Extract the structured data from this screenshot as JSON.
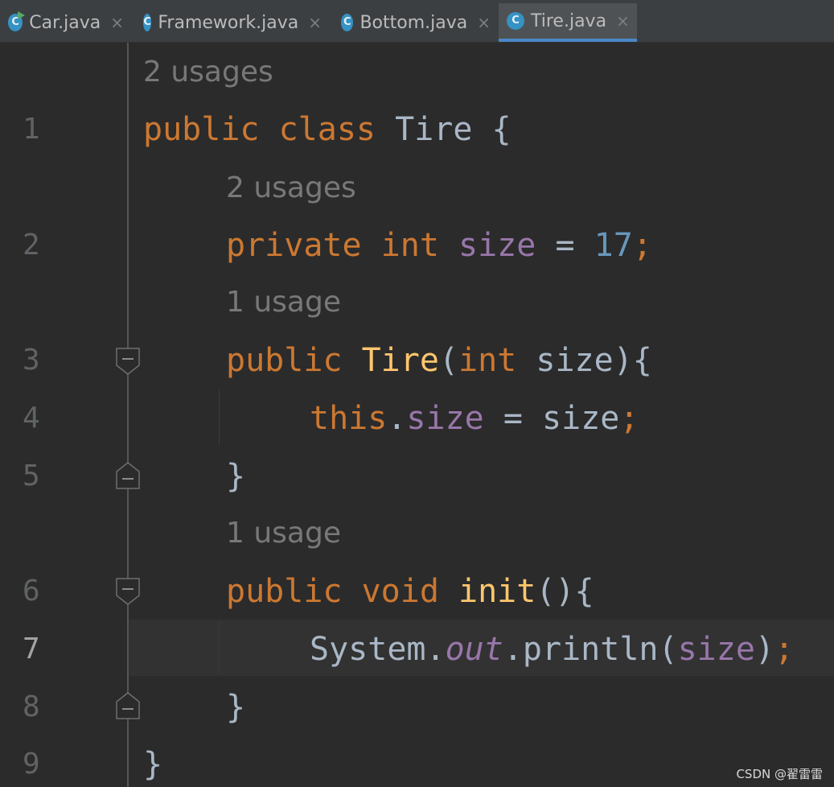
{
  "tabs": [
    {
      "label": "Car.java",
      "icon": "java-class-icon",
      "close": "×",
      "active": false,
      "runnable": true
    },
    {
      "label": "Framework.java",
      "icon": "java-class-icon",
      "close": "×",
      "active": false
    },
    {
      "label": "Bottom.java",
      "icon": "java-class-icon",
      "close": "×",
      "active": false
    },
    {
      "label": "Tire.java",
      "icon": "java-class-icon",
      "close": "×",
      "active": true
    }
  ],
  "file_icon_letter": "C",
  "line_numbers": [
    "1",
    "2",
    "3",
    "4",
    "5",
    "6",
    "7",
    "8",
    "9"
  ],
  "current_line": "7",
  "usage_hints": [
    "2 usages",
    "2 usages",
    "1 usage",
    "1 usage"
  ],
  "code": {
    "l1": {
      "a": "public",
      "b": "class",
      "c": "Tire",
      "d": "{"
    },
    "l2": {
      "a": "private",
      "b": "int",
      "c": "size",
      "d": "=",
      "e": "17",
      "f": ";"
    },
    "l3": {
      "a": "public",
      "b": "Tire",
      "c": "(",
      "d": "int",
      "e": "size",
      "f": "){"
    },
    "l4": {
      "a": "this",
      "b": ".",
      "c": "size",
      "d": "=",
      "e": "size",
      "f": ";"
    },
    "l5": {
      "a": "}"
    },
    "l6": {
      "a": "public",
      "b": "void",
      "c": "init",
      "d": "(){"
    },
    "l7": {
      "a": "System",
      "b": ".",
      "c": "out",
      "d": ".println(",
      "e": "size",
      "f": ")",
      "g": ";"
    },
    "l8": {
      "a": "}"
    },
    "l9": {
      "a": "}"
    }
  },
  "colors": {
    "background": "#2b2b2b",
    "keyword": "#cc7832",
    "field": "#9876aa",
    "method": "#ffc66d",
    "text": "#a9b7c6",
    "hint": "#787878",
    "tab_accent": "#4a88c7"
  },
  "watermark": "CSDN @翟雷雷"
}
